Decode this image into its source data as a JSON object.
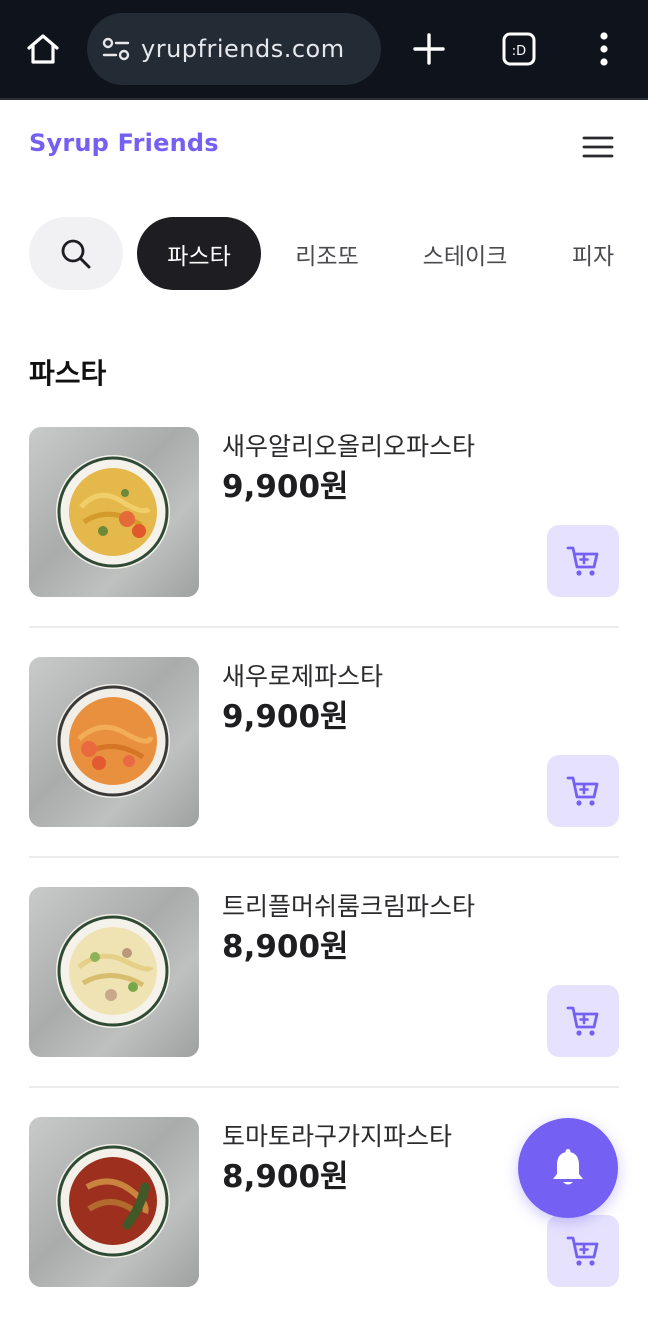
{
  "browser": {
    "url": "yrupfriends.com",
    "tab_count": ":D"
  },
  "site": {
    "logo": "Syrup Friends",
    "brand_color": "#7461f4"
  },
  "categories": [
    {
      "label": "파스타",
      "active": true
    },
    {
      "label": "리조또",
      "active": false
    },
    {
      "label": "스테이크",
      "active": false
    },
    {
      "label": "피자",
      "active": false
    }
  ],
  "section": {
    "title": "파스타"
  },
  "items": [
    {
      "name": "새우알리오올리오파스타",
      "price": "9,900원",
      "dish": "aglio-olio"
    },
    {
      "name": "새우로제파스타",
      "price": "9,900원",
      "dish": "rose"
    },
    {
      "name": "트리플머쉬룸크림파스타",
      "price": "8,900원",
      "dish": "cream"
    },
    {
      "name": "토마토라구가지파스타",
      "price": "8,900원",
      "dish": "tomato-ragu"
    }
  ],
  "icons": {
    "search": "search-icon",
    "cart": "cart-icon",
    "bell": "bell-icon",
    "hamburger": "menu-icon"
  }
}
